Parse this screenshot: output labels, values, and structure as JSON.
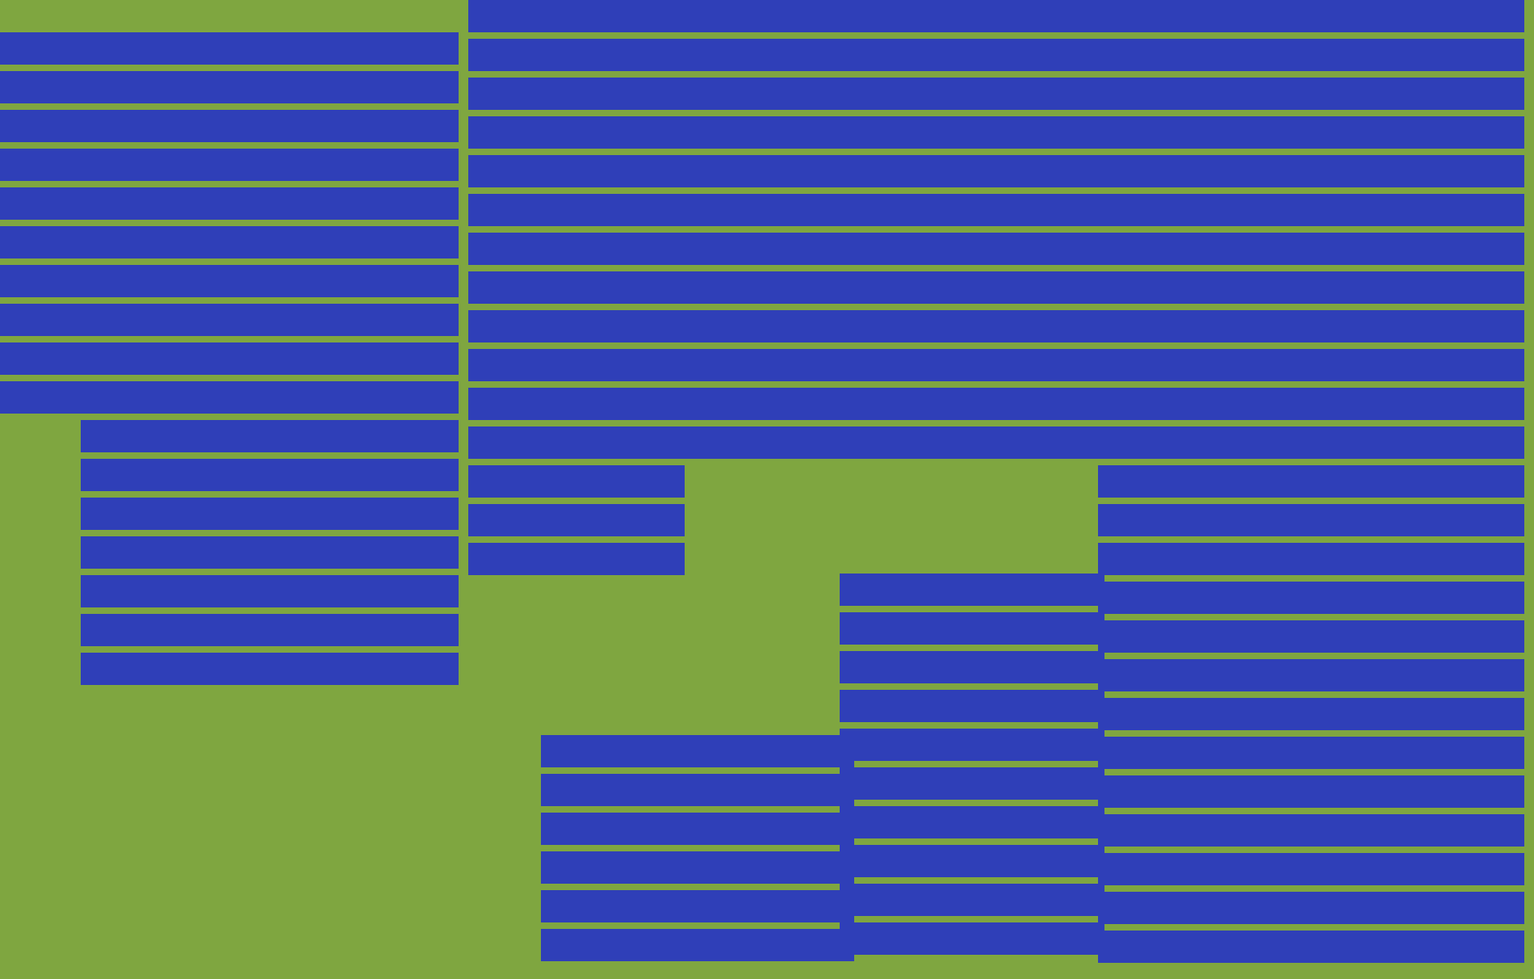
{
  "photo": {
    "kind": "aerial-photo"
  }
}
